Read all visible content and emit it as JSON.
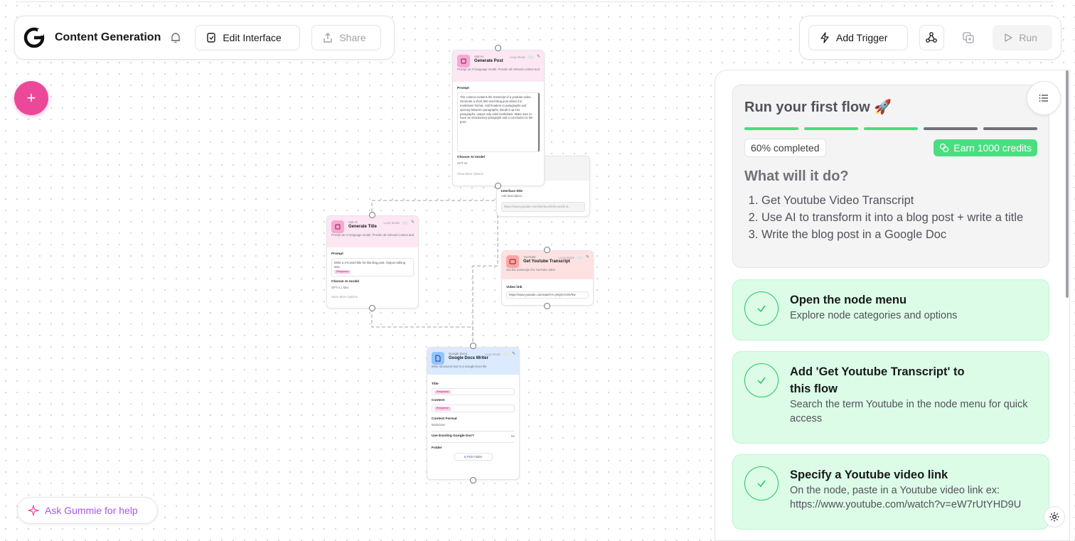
{
  "header": {
    "flow_title": "Content Generation",
    "edit_interface_label": "Edit Interface",
    "share_label": "Share",
    "add_trigger_label": "Add Trigger",
    "run_label": "Run"
  },
  "ask_gummie": {
    "label": "Ask Gummie for help"
  },
  "nodes": {
    "generate_post": {
      "category": "Ask AI",
      "name": "Generate Post",
      "loop_mode": "Loop Mode",
      "description": "Prompt an AI language model. Provide all relevant context and use detailed prompts to get the best results.",
      "prompt_label": "Prompt",
      "prompt_text": "The context contains the transcript of a youtube video. Generate a short 500 word blog post about it in markdown format. Add headers to paragraphs and spacing between paragraphs. Break it up into paragraphs, output only valid markdown. Make sure to have an introductory paragraph and a conclusion to the post.",
      "model_label": "Choose AI model",
      "model_value": "GPT-4o",
      "more_options": "Show More Options"
    },
    "interface": {
      "title_label": "Interface title",
      "title_placeholder": "Add description...",
      "link_text": "https://www.youtube.com/interface/hello-world-ai..."
    },
    "generate_title": {
      "category": "Ask AI",
      "name": "Generate Title",
      "loop_mode": "Loop Mode",
      "description": "Prompt an AI language model. Provide all relevant context and use detailed prompts to get the best results.",
      "prompt_label": "Prompt",
      "prompt_text": "Write a 3-5 word title for this blog post. Output nothing else.",
      "response_badge": "Response",
      "model_label": "Choose AI model",
      "model_value": "GPT-4.1 Mini",
      "more_options": "Show More Options"
    },
    "youtube": {
      "category": "YouTube",
      "name": "Get Youtube Transcript",
      "loop_mode": "Loop Mode",
      "description": "Get the transcript of a YouTube video",
      "link_label": "Video link",
      "link_value": "https://www.youtube.com/watch?v=jNQXAC9IVRw"
    },
    "docs": {
      "category": "Google Docs",
      "name": "Google Docs Writer",
      "loop_mode": "Loop Mode",
      "description": "Write structured text to a Google Docs file",
      "title_label": "Title",
      "title_badge": "Response",
      "content_label": "Content",
      "content_badge": "Response",
      "format_label": "Content Format",
      "format_value": "Markdown",
      "existing_label": "Use Existing Google Doc?",
      "existing_value": "No",
      "folder_label": "Folder",
      "folder_button": "Pick Folder"
    }
  },
  "panel": {
    "intro_title": "Run your first flow 🚀",
    "progress_fraction": 0.6,
    "progress_segments": 5,
    "progress_done_color": "#4ade80",
    "progress_todo_color": "#71717a",
    "completed_label": "60% completed",
    "credits_label": "Earn 1000 credits",
    "what_title": "What will it do?",
    "steps": [
      "Get Youtube Video Transcript",
      "Use AI to transform it into a blog post + write a title",
      "Write the blog post in a Google Doc"
    ],
    "tasks": [
      {
        "title": "Open the node menu",
        "desc": "Explore node categories and options"
      },
      {
        "title": "Add 'Get Youtube Transcript' to this flow",
        "desc": "Search the term Youtube in the node menu for quick access"
      },
      {
        "title": "Specify a Youtube video link",
        "desc": "On the node, paste in a Youtube video link ex: https://www.youtube.com/watch?v=eW7rUtYHD9U"
      }
    ]
  },
  "colors": {
    "accent_pink": "#ec4899",
    "success_green": "#22c55e",
    "task_bg": "#dcfce7"
  }
}
